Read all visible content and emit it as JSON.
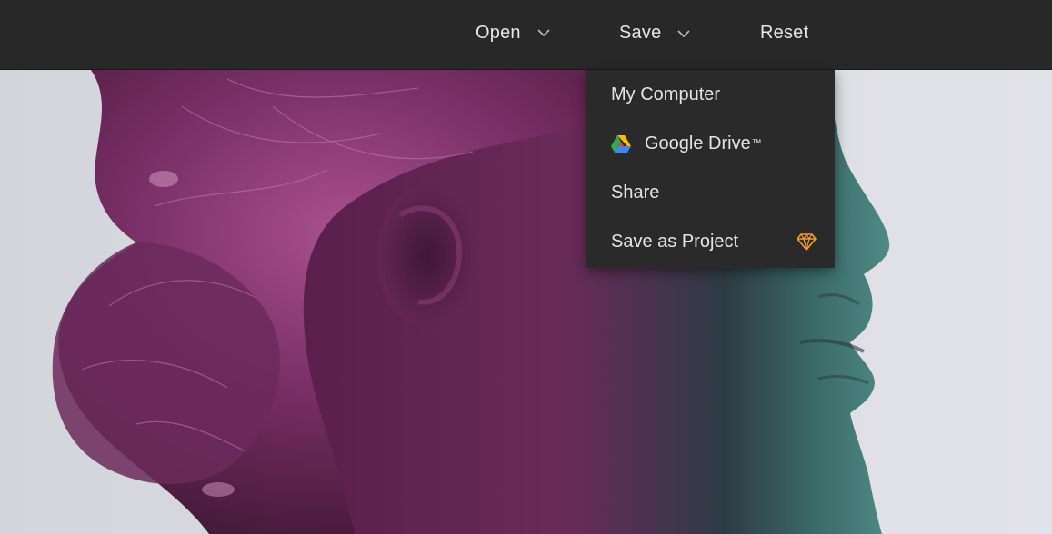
{
  "toolbar": {
    "open_label": "Open",
    "save_label": "Save",
    "reset_label": "Reset",
    "chevron_icon": "chevron-down-icon"
  },
  "save_menu": {
    "items": [
      {
        "label": "My Computer"
      },
      {
        "label": "Google Drive",
        "suffix": "™",
        "icon": "google-drive-icon"
      },
      {
        "label": "Share"
      },
      {
        "label": "Save as Project",
        "icon": "premium-diamond-icon"
      }
    ]
  },
  "colors": {
    "toolbar_bg": "#282828",
    "menu_bg": "#2a2a2a",
    "text": "#e6e6e6",
    "premium_accent": "#f39c32"
  }
}
